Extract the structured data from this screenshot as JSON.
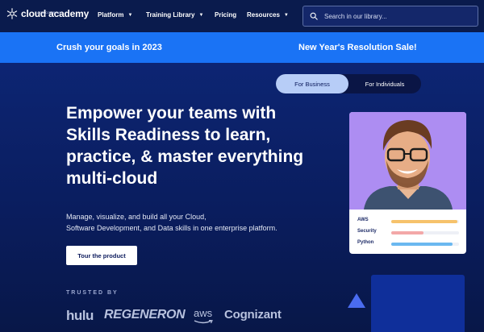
{
  "brand": {
    "name": "cloud academy",
    "tagline": "A QA COMPANY"
  },
  "nav": {
    "items": [
      {
        "label": "Platform",
        "has_dropdown": true
      },
      {
        "label": "Training Library",
        "has_dropdown": true
      },
      {
        "label": "Pricing",
        "has_dropdown": false
      },
      {
        "label": "Resources",
        "has_dropdown": true
      }
    ],
    "search_placeholder": "Search in our library..."
  },
  "promo": {
    "left": "Crush your goals in 2023",
    "right": "New Year's Resolution Sale!"
  },
  "toggle": {
    "business": "For Business",
    "individuals": "For Individuals",
    "selected": "business"
  },
  "hero": {
    "headline": "Empower your teams with Skills Readiness to learn, practice, & master everything multi-cloud",
    "subtext_line1": "Manage, visualize, and build all your Cloud,",
    "subtext_line2": "Software Development, and Data skills in one enterprise platform.",
    "cta": "Tour the product"
  },
  "trusted": {
    "label": "TRUSTED BY",
    "logos": [
      "hulu",
      "REGENERON",
      "aws",
      "Cognizant"
    ]
  },
  "skills_card": {
    "skills": [
      {
        "name": "AWS",
        "level": 0.98,
        "color": "#f6c26b"
      },
      {
        "name": "Security",
        "level": 0.48,
        "color": "#f3a8a8"
      },
      {
        "name": "Python",
        "level": 0.9,
        "color": "#6bb8f0"
      }
    ]
  },
  "colors": {
    "nav_bg": "#0a1b4d",
    "promo_bg": "#1a73f5",
    "hero_bg": "#0d2573",
    "accent": "#b7cdf7"
  }
}
